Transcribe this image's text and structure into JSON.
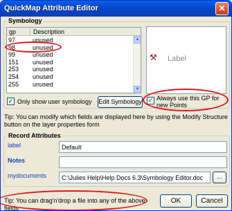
{
  "window": {
    "title": "QuickMap Attribute Editor",
    "close_glyph": "✕"
  },
  "symbology": {
    "group_label": "Symbology",
    "columns": {
      "gp": "gp",
      "description": "Description"
    },
    "rows": [
      {
        "gp": "97",
        "description": "unused"
      },
      {
        "gp": "98",
        "description": "unused"
      },
      {
        "gp": "99",
        "description": "unused"
      },
      {
        "gp": "151",
        "description": "unused"
      },
      {
        "gp": "253",
        "description": "unused"
      },
      {
        "gp": "254",
        "description": "unused"
      },
      {
        "gp": "255",
        "description": "unused"
      },
      {
        "gp": "",
        "description": ""
      }
    ],
    "only_user_label": "Only show user symbology",
    "only_user_checked": true,
    "edit_button": "Edit Symbology",
    "preview_label": "Label",
    "preview_icon": "tools-icon",
    "always_use_label_1": "Always use this GP for",
    "always_use_label_2": "new Points",
    "always_use_checked": true
  },
  "tip_modify": {
    "line1": "Tip: You can modify which fields are displayed here by using the Modify Structure",
    "line2": "button on the layer properties form"
  },
  "record": {
    "group_label": "Record Attributes",
    "label_field": {
      "name": "label",
      "value": "Default"
    },
    "notes_field": {
      "name": "Notes",
      "value": ""
    },
    "mydocs_field": {
      "name": "mydocuments",
      "value": "C:\\Julies Help\\Help Docs 6.3\\Symbology Editor.doc"
    },
    "browse_button": "..."
  },
  "tip_drag": {
    "line1": "Tip: You can drag'n'drop a file into any of the above",
    "line2": "fields"
  },
  "footer": {
    "ok": "OK",
    "cancel": "Cancel"
  },
  "annotation_color": "#e0131a"
}
